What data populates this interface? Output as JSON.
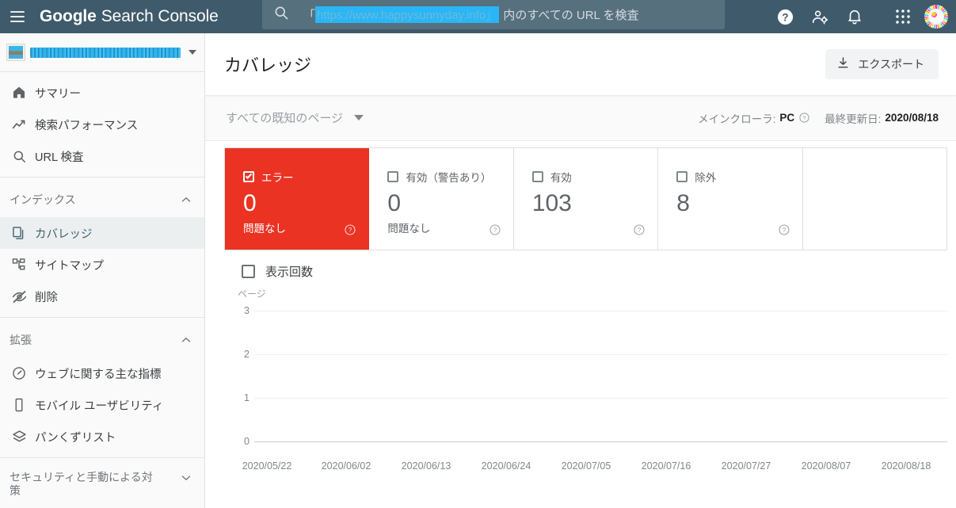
{
  "topbar": {
    "menu_icon": "hamburger-menu-icon",
    "brand_first": "Google",
    "brand_rest": "Search Console",
    "search": {
      "icon": "search-icon",
      "prefix": "「",
      "redacted_url": "https://www.happysunnyday.info」",
      "suffix": "内のすべての URL を検査"
    },
    "icons": {
      "help": "help-icon",
      "account_settings": "person-gear-icon",
      "notifications": "bell-icon",
      "apps": "apps-grid-icon",
      "avatar": "user-avatar"
    }
  },
  "sidebar": {
    "site_selector": {
      "name_redacted": "https://www.happysunnyday.info/",
      "caret": "chevron-down-icon"
    },
    "primary_items": [
      {
        "label": "サマリー",
        "icon": "home-icon",
        "active": false
      },
      {
        "label": "検索パフォーマンス",
        "icon": "trending-up-icon",
        "active": false
      },
      {
        "label": "URL 検査",
        "icon": "search-icon",
        "active": false
      }
    ],
    "groups": [
      {
        "title": "インデックス",
        "expanded": true,
        "chevron": "chevron-up-icon",
        "items": [
          {
            "label": "カバレッジ",
            "icon": "pages-copy-icon",
            "active": true
          },
          {
            "label": "サイトマップ",
            "icon": "sitemap-icon",
            "active": false
          },
          {
            "label": "削除",
            "icon": "eye-off-icon",
            "active": false
          }
        ]
      },
      {
        "title": "拡張",
        "expanded": true,
        "chevron": "chevron-up-icon",
        "items": [
          {
            "label": "ウェブに関する主な指標",
            "icon": "speedometer-icon",
            "active": false
          },
          {
            "label": "モバイル ユーザビリティ",
            "icon": "mobile-phone-icon",
            "active": false
          },
          {
            "label": "パンくずリスト",
            "icon": "layers-icon",
            "active": false
          }
        ]
      },
      {
        "title": "セキュリティと手動による対策",
        "expanded": false,
        "chevron": "chevron-down-icon",
        "items": []
      }
    ]
  },
  "header": {
    "title": "カバレッジ",
    "export_label": "エクスポート",
    "export_icon": "download-icon"
  },
  "subbar": {
    "filter_label": "すべての既知のページ",
    "filter_caret": "chevron-down-icon",
    "crawler_label": "メインクローラ:",
    "crawler_value": "PC",
    "crawler_help_icon": "help-circle-icon",
    "updated_label": "最終更新日:",
    "updated_value": "2020/08/18"
  },
  "cards": [
    {
      "label": "エラー",
      "value": "0",
      "sub": "問題なし",
      "selected": true,
      "checked": true,
      "help_icon": "help-circle-icon",
      "color": "#ea3323"
    },
    {
      "label": "有効（警告あり）",
      "value": "0",
      "sub": "問題なし",
      "selected": false,
      "checked": false,
      "help_icon": "help-circle-icon"
    },
    {
      "label": "有効",
      "value": "103",
      "sub": "",
      "selected": false,
      "checked": false,
      "help_icon": "help-circle-icon"
    },
    {
      "label": "除外",
      "value": "8",
      "sub": "",
      "selected": false,
      "checked": false,
      "help_icon": "help-circle-icon"
    }
  ],
  "chart_data": {
    "type": "line",
    "title": "",
    "legend": [
      {
        "name": "表示回数",
        "checked": false
      }
    ],
    "legend_position": "top-left",
    "ylabel": "ページ",
    "xlabel": "",
    "ylim": [
      0,
      3
    ],
    "yticks": [
      "0",
      "1",
      "2",
      "3"
    ],
    "grid": true,
    "x": [
      "2020/05/22",
      "2020/06/02",
      "2020/06/13",
      "2020/06/24",
      "2020/07/05",
      "2020/07/16",
      "2020/07/27",
      "2020/08/07",
      "2020/08/18"
    ],
    "series": [
      {
        "name": "エラー",
        "values": [
          0,
          0,
          0,
          0,
          0,
          0,
          0,
          0,
          0
        ],
        "color": "#ea3323"
      }
    ]
  }
}
